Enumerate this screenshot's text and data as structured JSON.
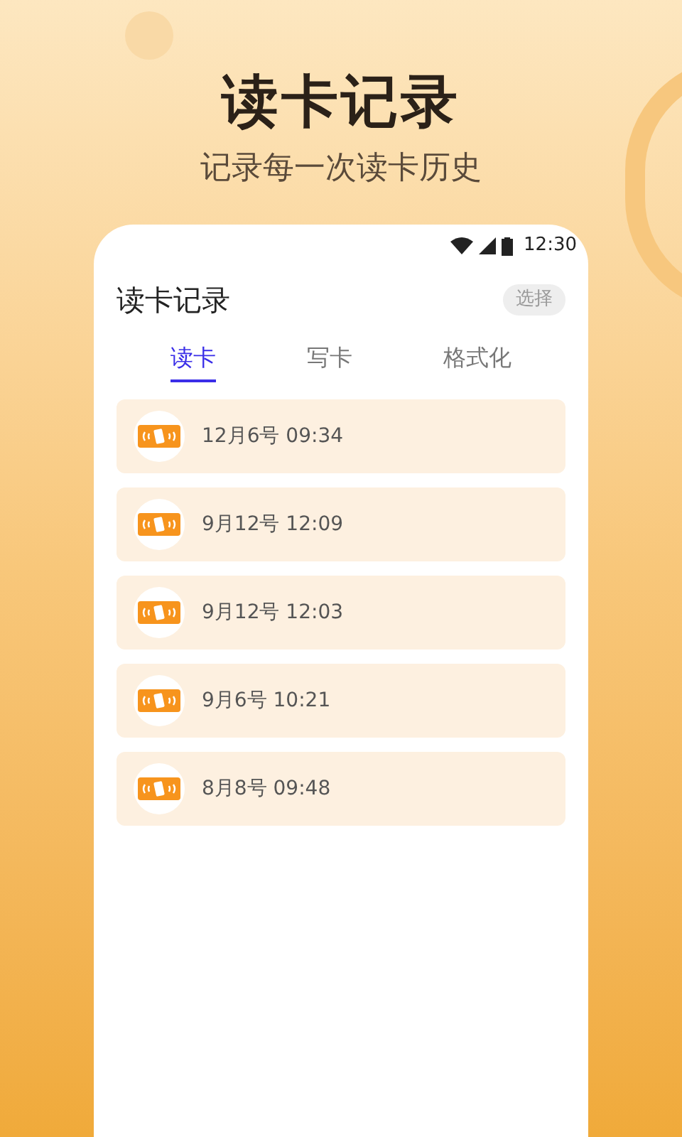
{
  "headline": "读卡记录",
  "subtitle": "记录每一次读卡历史",
  "status_bar": {
    "time": "12:30"
  },
  "app_bar": {
    "title": "读卡记录",
    "action": "选择"
  },
  "tabs": [
    {
      "label": "读卡",
      "selected": true
    },
    {
      "label": "写卡",
      "selected": false
    },
    {
      "label": "格式化",
      "selected": false
    }
  ],
  "records": [
    {
      "time": "12月6号 09:34"
    },
    {
      "time": "9月12号 12:09"
    },
    {
      "time": "9月12号 12:03"
    },
    {
      "time": "9月6号 10:21"
    },
    {
      "time": "8月8号 09:48"
    }
  ]
}
